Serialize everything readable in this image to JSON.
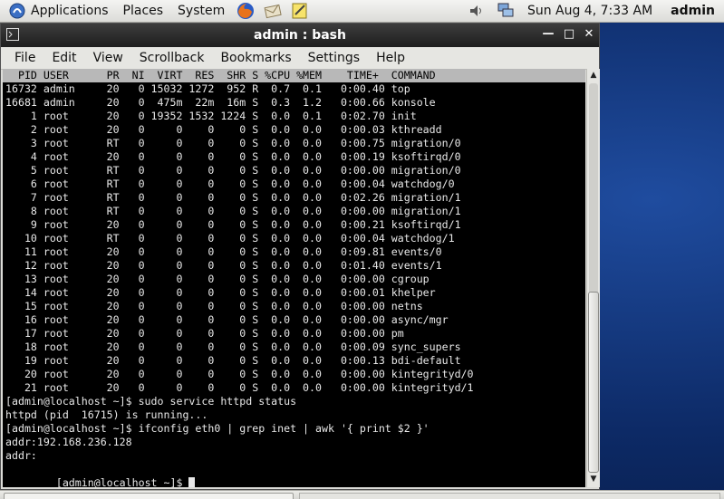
{
  "panel": {
    "applications": "Applications",
    "places": "Places",
    "system": "System",
    "clock": "Sun Aug  4,  7:33 AM",
    "user": "admin",
    "launchers": [
      "firefox-icon",
      "email-icon",
      "notes-icon"
    ],
    "tray": [
      "volume-icon",
      "network-icon"
    ]
  },
  "window": {
    "title": "admin : bash",
    "menu": [
      "File",
      "Edit",
      "View",
      "Scrollback",
      "Bookmarks",
      "Settings",
      "Help"
    ]
  },
  "terminal": {
    "header": "  PID USER      PR  NI  VIRT  RES  SHR S %CPU %MEM    TIME+  COMMAND",
    "rows": [
      "16732 admin     20   0 15032 1272  952 R  0.7  0.1   0:00.40 top",
      "16681 admin     20   0  475m  22m  16m S  0.3  1.2   0:00.66 konsole",
      "    1 root      20   0 19352 1532 1224 S  0.0  0.1   0:02.70 init",
      "    2 root      20   0     0    0    0 S  0.0  0.0   0:00.03 kthreadd",
      "    3 root      RT   0     0    0    0 S  0.0  0.0   0:00.75 migration/0",
      "    4 root      20   0     0    0    0 S  0.0  0.0   0:00.19 ksoftirqd/0",
      "    5 root      RT   0     0    0    0 S  0.0  0.0   0:00.00 migration/0",
      "    6 root      RT   0     0    0    0 S  0.0  0.0   0:00.04 watchdog/0",
      "    7 root      RT   0     0    0    0 S  0.0  0.0   0:02.26 migration/1",
      "    8 root      RT   0     0    0    0 S  0.0  0.0   0:00.00 migration/1",
      "    9 root      20   0     0    0    0 S  0.0  0.0   0:00.21 ksoftirqd/1",
      "   10 root      RT   0     0    0    0 S  0.0  0.0   0:00.04 watchdog/1",
      "   11 root      20   0     0    0    0 S  0.0  0.0   0:09.81 events/0",
      "   12 root      20   0     0    0    0 S  0.0  0.0   0:01.40 events/1",
      "   13 root      20   0     0    0    0 S  0.0  0.0   0:00.00 cgroup",
      "   14 root      20   0     0    0    0 S  0.0  0.0   0:00.01 khelper",
      "   15 root      20   0     0    0    0 S  0.0  0.0   0:00.00 netns",
      "   16 root      20   0     0    0    0 S  0.0  0.0   0:00.00 async/mgr",
      "   17 root      20   0     0    0    0 S  0.0  0.0   0:00.00 pm",
      "   18 root      20   0     0    0    0 S  0.0  0.0   0:00.09 sync_supers",
      "   19 root      20   0     0    0    0 S  0.0  0.0   0:00.13 bdi-default",
      "   20 root      20   0     0    0    0 S  0.0  0.0   0:00.00 kintegrityd/0",
      "   21 root      20   0     0    0    0 S  0.0  0.0   0:00.00 kintegrityd/1"
    ],
    "output": [
      "[admin@localhost ~]$ sudo service httpd status",
      "httpd (pid  16715) is running...",
      "[admin@localhost ~]$ ifconfig eth0 | grep inet | awk '{ print $2 }'",
      "addr:192.168.236.128",
      "addr:"
    ],
    "prompt": "[admin@localhost ~]$ "
  },
  "colors": {
    "terminal_bg": "#000000",
    "terminal_fg": "#e8e8e8",
    "titlebar": "#2a2a2a",
    "desktop": "#0d2a66"
  }
}
